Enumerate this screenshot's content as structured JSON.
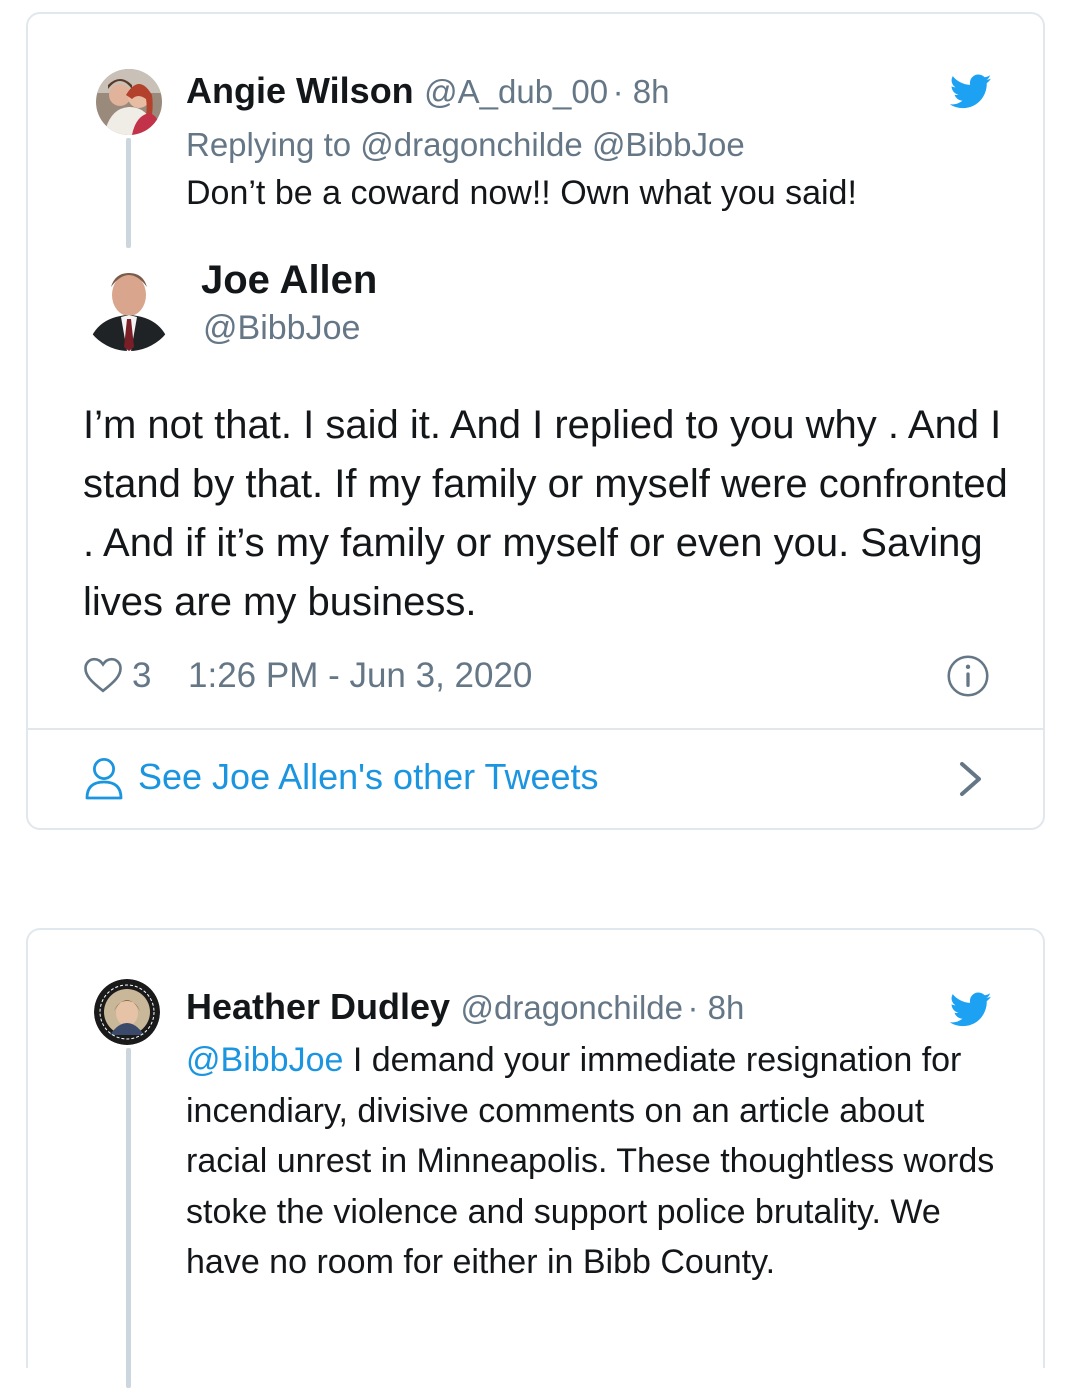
{
  "reply_tweet": {
    "name": "Angie Wilson",
    "handle": "@A_dub_00",
    "time": "· 8h",
    "replying_label": "Replying to",
    "replying_to_1": "@dragonchilde",
    "replying_to_2": "@BibbJoe",
    "text": "Don’t be a coward now!! Own what you said!"
  },
  "main_tweet": {
    "name": "Joe Allen",
    "handle": "@BibbJoe",
    "text": "I’m not that.  I said it.  And I replied to you why .  And I stand by that.  If my family or myself were confronted . And if it’s my family or myself or even you. Saving  lives are my business.",
    "likes": "3",
    "timestamp": "1:26 PM - Jun 3, 2020",
    "other_tweets_link": "See Joe Allen's other Tweets"
  },
  "second_card": {
    "name": "Heather Dudley",
    "handle": "@dragonchilde",
    "time": "· 8h",
    "mention": "@BibbJoe",
    "text": " I demand your immediate resignation for incendiary, divisive comments on an article about racial unrest in Minneapolis. These thoughtless words stoke the violence and support police brutality. We have no room for either in Bibb County.",
    "avatar_badge_text": "BLACK LIVES MATTER"
  },
  "colors": {
    "twitter_blue": "#1da1f2",
    "link_blue": "#1b95e0",
    "secondary_text": "#657786",
    "border": "#e1e8ed"
  },
  "icons": [
    "twitter-bird-icon",
    "heart-icon",
    "info-icon",
    "user-icon",
    "chevron-right-icon"
  ]
}
